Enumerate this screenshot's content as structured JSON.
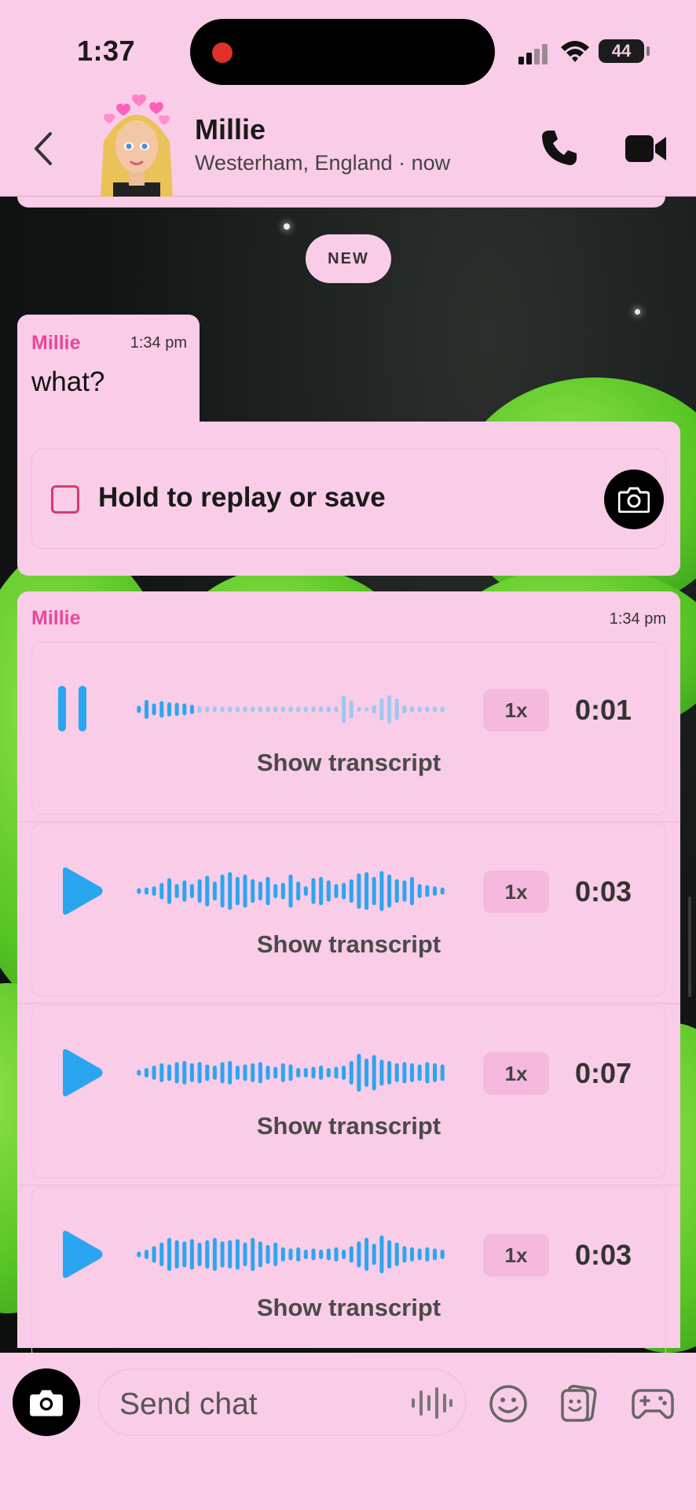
{
  "status": {
    "time": "1:37",
    "battery": "44"
  },
  "header": {
    "name": "Millie",
    "subtitle": "Westerham, England · now"
  },
  "new_label": "NEW",
  "message1": {
    "sender": "Millie",
    "time": "1:34 pm",
    "text": "what?"
  },
  "replay": {
    "label": "Hold to replay or save"
  },
  "voice": {
    "sender": "Millie",
    "time": "1:34 pm",
    "transcript_label": "Show transcript",
    "notes": [
      {
        "state": "playing",
        "speed": "1x",
        "duration": "0:01"
      },
      {
        "state": "paused",
        "speed": "1x",
        "duration": "0:03"
      },
      {
        "state": "paused",
        "speed": "1x",
        "duration": "0:07"
      },
      {
        "state": "paused",
        "speed": "1x",
        "duration": "0:03"
      }
    ]
  },
  "input": {
    "placeholder": "Send chat"
  },
  "colors": {
    "accent": "#2aa6f0",
    "sender": "#e8489a",
    "background": "#f9cce8"
  }
}
